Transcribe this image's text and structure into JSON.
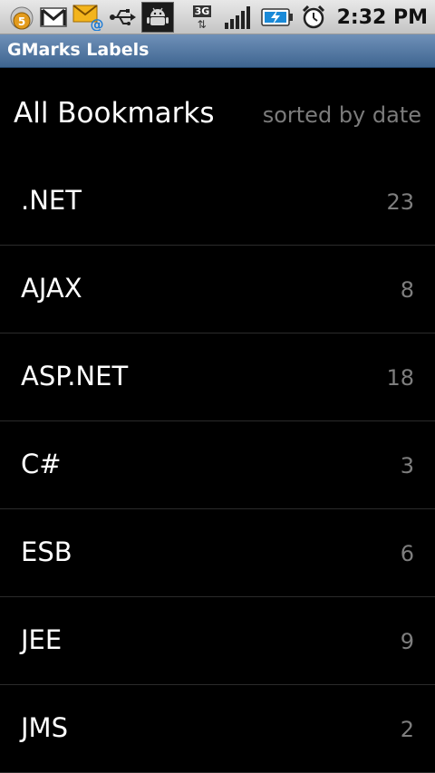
{
  "statusbar": {
    "badge_count": "5",
    "network": "3G",
    "time": "2:32 PM",
    "icons": [
      "notification-badge-icon",
      "gmail-icon",
      "email-icon",
      "usb-icon",
      "android-debug-icon",
      "3g-data-icon",
      "signal-icon",
      "battery-charging-icon",
      "alarm-icon"
    ]
  },
  "titlebar": {
    "title": "GMarks Labels"
  },
  "header": {
    "title": "All Bookmarks",
    "sort": "sorted by date"
  },
  "labels": [
    {
      "name": ".NET",
      "count": "23"
    },
    {
      "name": "AJAX",
      "count": "8"
    },
    {
      "name": "ASP.NET",
      "count": "18"
    },
    {
      "name": "C#",
      "count": "3"
    },
    {
      "name": "ESB",
      "count": "6"
    },
    {
      "name": "JEE",
      "count": "9"
    },
    {
      "name": "JMS",
      "count": "2"
    }
  ],
  "colors": {
    "background": "#000000",
    "titlebar": "#4a6f99",
    "secondary_text": "#7b7b7b"
  }
}
